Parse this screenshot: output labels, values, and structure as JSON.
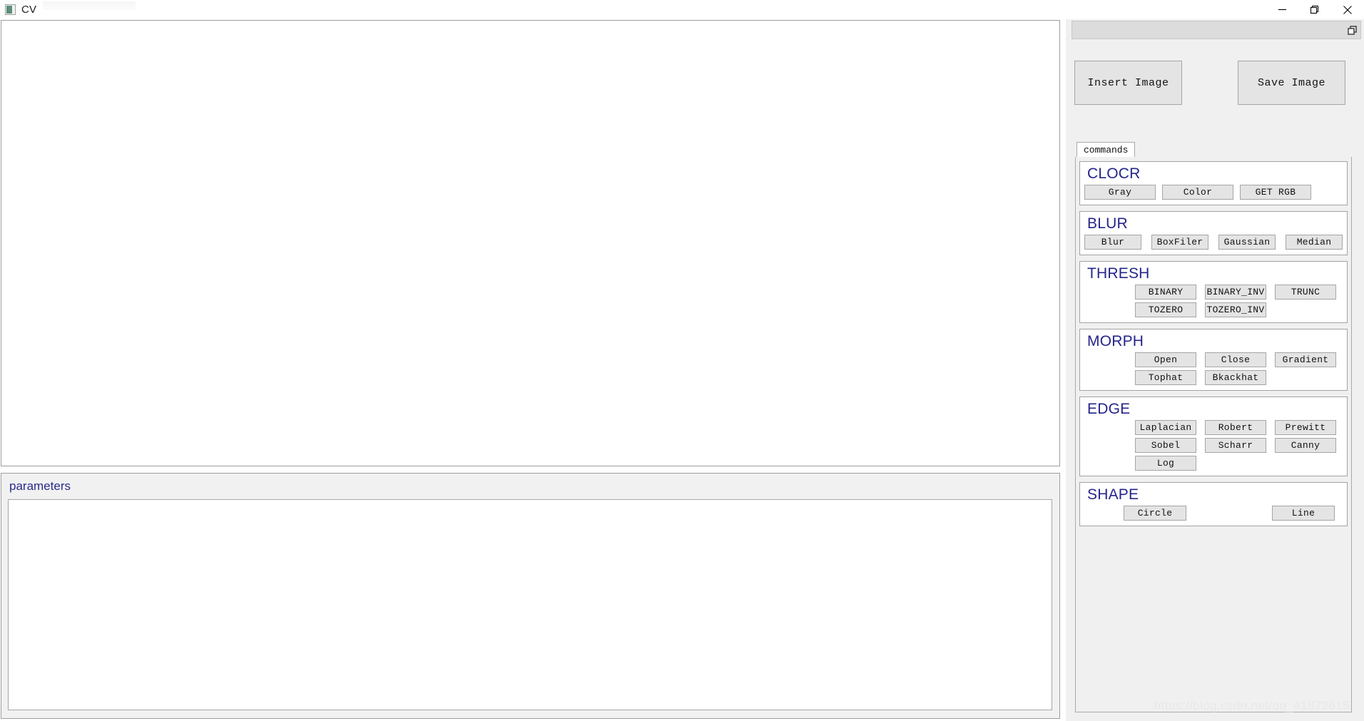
{
  "window": {
    "title": "CV",
    "icon": "app-icon",
    "controls": [
      {
        "name": "minimize",
        "glyph": "minimize-icon"
      },
      {
        "name": "restore",
        "glyph": "restore-icon"
      },
      {
        "name": "close",
        "glyph": "close-icon"
      }
    ]
  },
  "left_panel": {
    "image_canvas": {
      "content": ""
    },
    "parameters": {
      "label": "parameters",
      "body": ""
    }
  },
  "right_panel": {
    "dock": {
      "float_icon": "restore-small-icon"
    },
    "io_buttons": {
      "insert": "Insert Image",
      "save": "Save Image"
    },
    "tabs": [
      {
        "label": "commands",
        "active": true
      }
    ],
    "groups": [
      {
        "title": "CLOCR",
        "layout": "row-left",
        "rows": [
          [
            "Gray",
            "Color",
            "GET RGB"
          ]
        ]
      },
      {
        "title": "BLUR",
        "layout": "grid4",
        "rows": [
          [
            "Blur",
            "BoxFiler",
            "Gaussian",
            "Median"
          ]
        ]
      },
      {
        "title": "THRESH",
        "layout": "grid3",
        "rows": [
          [
            "BINARY",
            "BINARY_INV",
            "TRUNC"
          ],
          [
            "TOZERO",
            "TOZERO_INV"
          ]
        ]
      },
      {
        "title": "MORPH",
        "layout": "grid3",
        "rows": [
          [
            "Open",
            "Close",
            "Gradient"
          ],
          [
            "Tophat",
            "Bkackhat"
          ]
        ]
      },
      {
        "title": "EDGE",
        "layout": "grid3",
        "rows": [
          [
            "Laplacian",
            "Robert",
            "Prewitt"
          ],
          [
            "Sobel",
            "Scharr",
            "Canny"
          ],
          [
            "Log"
          ]
        ]
      },
      {
        "title": "SHAPE",
        "layout": "grid2",
        "rows": [
          [
            "Circle",
            "Line"
          ]
        ]
      }
    ]
  },
  "watermark": "https://blog.csdn.net/qq_41872615",
  "colors": {
    "group_title": "#25258c",
    "parameters_label": "#2a2a8c",
    "button_face": "#e4e4e4",
    "button_border": "#a5a5a5",
    "panel_bg": "#f0f0f0",
    "canvas_bg": "#ffffff"
  }
}
